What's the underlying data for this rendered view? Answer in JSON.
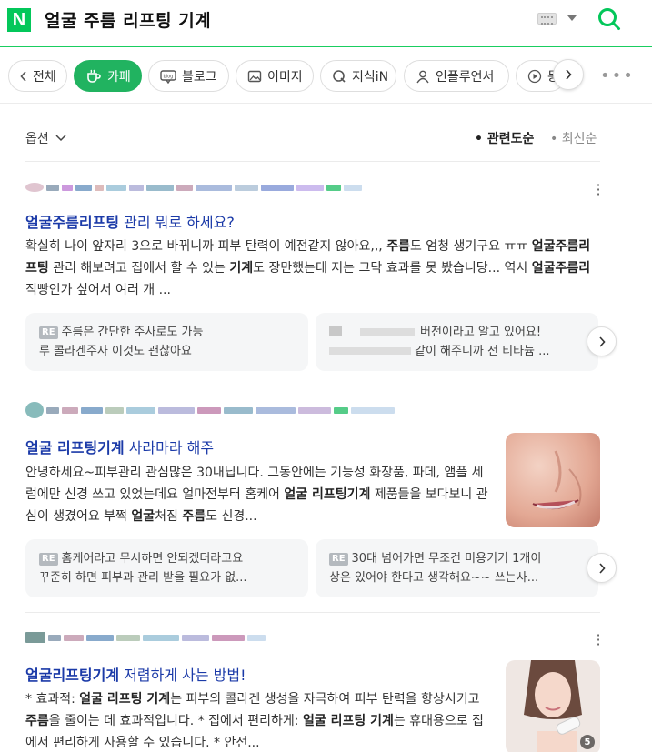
{
  "header": {
    "logo": "N",
    "query": "얼굴 주름 리프팅 기계",
    "icons": [
      "keyboard-icon",
      "dropdown-icon",
      "search-icon"
    ]
  },
  "tabs": [
    {
      "label": "전체",
      "icon": "chevron-left-icon"
    },
    {
      "label": "카페",
      "icon": "cafe-cup-icon",
      "active": true
    },
    {
      "label": "블로그",
      "icon": "blog-icon"
    },
    {
      "label": "이미지",
      "icon": "image-icon"
    },
    {
      "label": "지식iN",
      "icon": "qa-icon"
    },
    {
      "label": "인플루언서",
      "icon": "person-icon"
    },
    {
      "label": "동",
      "icon": "play-icon"
    }
  ],
  "sort": {
    "options_label": "옵션",
    "related": "관련도순",
    "recent": "최신순"
  },
  "results": [
    {
      "title_highlight": "얼굴주름리프팅",
      "title_rest": " 관리 뭐로 하세요?",
      "body_parts": [
        {
          "t": "확실히 나이 앞자리 3으로 바뀌니까 피부 탄력이 예전같지 않아요,,, "
        },
        {
          "t": "주름",
          "b": true
        },
        {
          "t": "도 엄청 생기구요 ㅠㅠ "
        },
        {
          "t": "얼굴주름리프팅",
          "b": true
        },
        {
          "t": " 관리 해보려고 집에서 할 수 있는 "
        },
        {
          "t": "기계",
          "b": true
        },
        {
          "t": "도 장만했는데 저는 그닥 효과를 못 봤습니당... 역시 "
        },
        {
          "t": "얼굴주름리",
          "b": true
        },
        {
          "t": "                         직빵인가 싶어서 여러 개 ..."
        }
      ],
      "comments": [
        "주름은 간단한 주사로도 가능",
        "루 콜라겐주사 이것도 괜찮아요",
        "버전이라고 알고 있어요!",
        "같이 해주니까 전 티타늄 ..."
      ],
      "comment_tag": "RE"
    },
    {
      "title_highlight": "얼굴 리프팅기계",
      "title_rest": " 사라마라 해주",
      "body_parts": [
        {
          "t": "안녕하세요~피부관리 관심많은 30내닙니다. 그동안에는 기능성 화장품, 파데, 앰플 세럼에만 신경 쓰고 있었는데요 얼마전부터 홈케어 "
        },
        {
          "t": "얼굴 리프팅기계",
          "b": true
        },
        {
          "t": " 제품들을 보다보니 관심이 생겼어요 부쩍 "
        },
        {
          "t": "얼굴",
          "b": true
        },
        {
          "t": "처짐 "
        },
        {
          "t": "주름",
          "b": true
        },
        {
          "t": "도 신경..."
        }
      ],
      "comments": [
        "홈케어라고 무시하면 안되겠더라고요",
        "꾸준히 하면 피부과 관리 받을 필요가 없...",
        "30대 넘어가면 무조건 미용기기 1개이",
        "상은 있어야 한다고 생각해요~~ 쓰는사..."
      ],
      "comment_tag": "RE"
    },
    {
      "title_highlight": "얼굴리프팅기계",
      "title_rest": " 저렴하게 사는 방법!",
      "body_parts": [
        {
          "t": "* 효과적: "
        },
        {
          "t": "얼굴 리프팅 기계",
          "b": true
        },
        {
          "t": "는 피부의 콜라겐 생성을 자극하여 피부 탄력을 향상시키고 "
        },
        {
          "t": "주름",
          "b": true
        },
        {
          "t": "을 줄이는 데 효과적입니다. * 집에서 편리하게: "
        },
        {
          "t": "얼굴 리프팅 기계",
          "b": true
        },
        {
          "t": "는 휴대용으로 집에서 편리하게 사용할 수 있습니다. * 안전..."
        }
      ],
      "image_count": "5"
    }
  ],
  "colors": {
    "accent": "#03c75a",
    "active_tab": "#21b360",
    "title_link": "#1b3aa8"
  }
}
